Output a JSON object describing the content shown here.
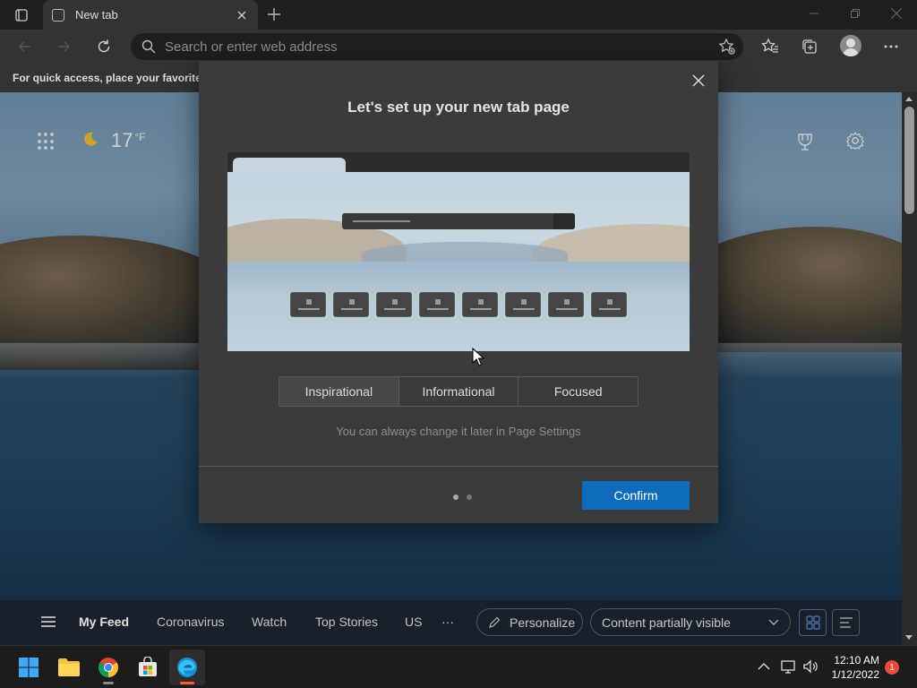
{
  "browser": {
    "tab_title": "New tab",
    "address_placeholder": "Search or enter web address",
    "favorites_bar_text": "For quick access, place your favorites h"
  },
  "ntp": {
    "weather_temp": "17",
    "weather_unit": "°F"
  },
  "modal": {
    "title": "Let's set up your new tab page",
    "layout_options": [
      "Inspirational",
      "Informational",
      "Focused"
    ],
    "selected_option": "Inspirational",
    "hint": "You can always change it later in Page Settings",
    "confirm_label": "Confirm",
    "step_current": 1,
    "step_total": 2
  },
  "feed": {
    "items": [
      "My Feed",
      "Coronavirus",
      "Watch",
      "Top Stories",
      "US"
    ],
    "more": "···",
    "personalize_label": "Personalize",
    "visibility_label": "Content partially visible"
  },
  "taskbar": {
    "time": "12:10 AM",
    "date": "1/12/2022",
    "notification_count": "1"
  },
  "colors": {
    "accent": "#0f6cbd",
    "modal_bg": "#3b3b3b",
    "notification": "#e74b3c"
  }
}
